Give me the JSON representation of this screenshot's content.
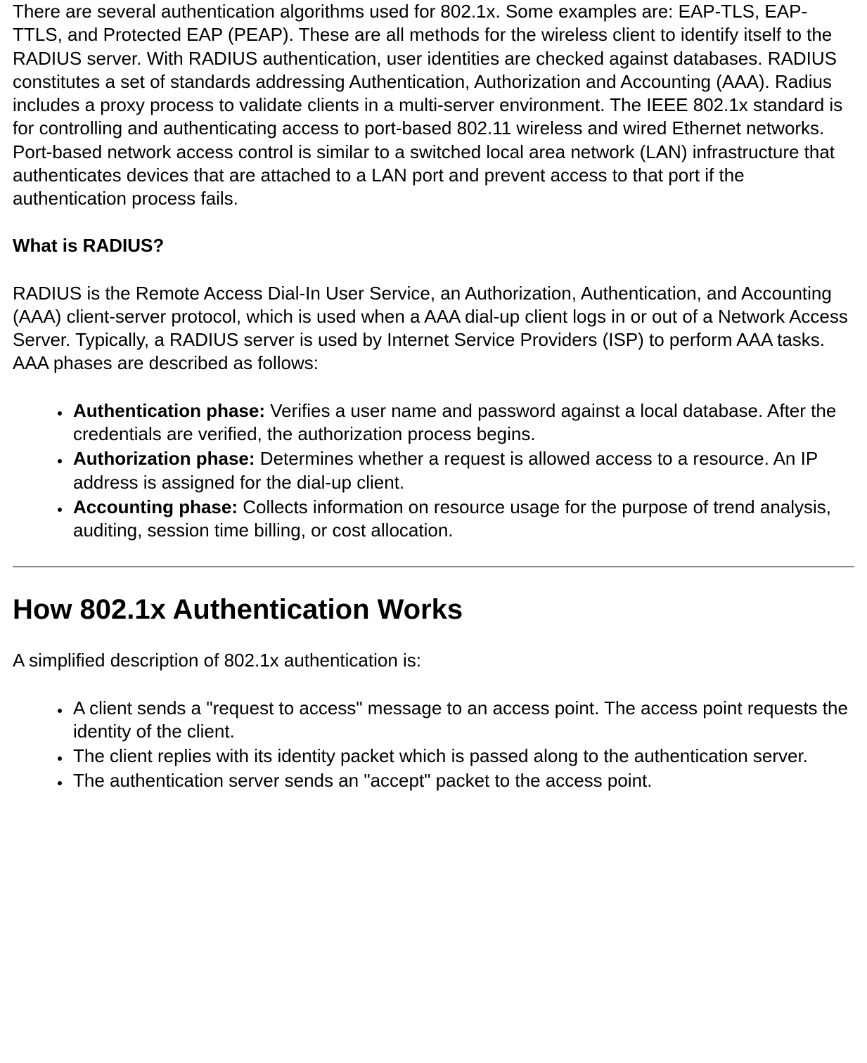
{
  "intro_para": "There are several authentication algorithms used for 802.1x. Some examples are: EAP-TLS, EAP-TTLS, and Protected EAP (PEAP). These are all methods for the wireless client to identify itself to the RADIUS server. With RADIUS authentication, user identities are checked against databases. RADIUS constitutes a set of standards addressing Authentication, Authorization and Accounting (AAA). Radius includes a proxy process to validate clients in a multi-server environment. The IEEE 802.1x standard is for controlling and authenticating access to port-based 802.11 wireless and wired Ethernet networks. Port-based network access control is similar to a switched local area network (LAN) infrastructure that authenticates devices that are attached to a LAN port and prevent access to that port if the authentication process fails.",
  "radius_heading": "What is RADIUS?",
  "radius_para": "RADIUS is the Remote Access Dial-In User Service, an Authorization, Authentication, and Accounting (AAA) client-server protocol, which is used when a AAA dial-up client logs in or out of a Network Access Server. Typically, a RADIUS server is used by Internet Service Providers (ISP) to perform AAA tasks. AAA phases are described as follows:",
  "aaa_phases": [
    {
      "label": "Authentication phase:",
      "text": " Verifies a user name and password against a local database. After the credentials are verified, the authorization process begins."
    },
    {
      "label": "Authorization phase:",
      "text": " Determines whether a request is allowed access to a resource. An IP address is assigned for the dial-up client."
    },
    {
      "label": "Accounting phase:",
      "text": " Collects information on resource usage for the purpose of trend analysis, auditing, session time billing, or cost allocation."
    }
  ],
  "how_heading": "How 802.1x Authentication Works",
  "how_para": "A simplified description of 802.1x authentication is:",
  "how_steps": [
    "A client sends a \"request to access\" message to an access point. The access point requests the identity of the client.",
    "The client replies with its identity packet which is passed along to the authentication server.",
    "The authentication server sends an \"accept\" packet to the access point."
  ]
}
